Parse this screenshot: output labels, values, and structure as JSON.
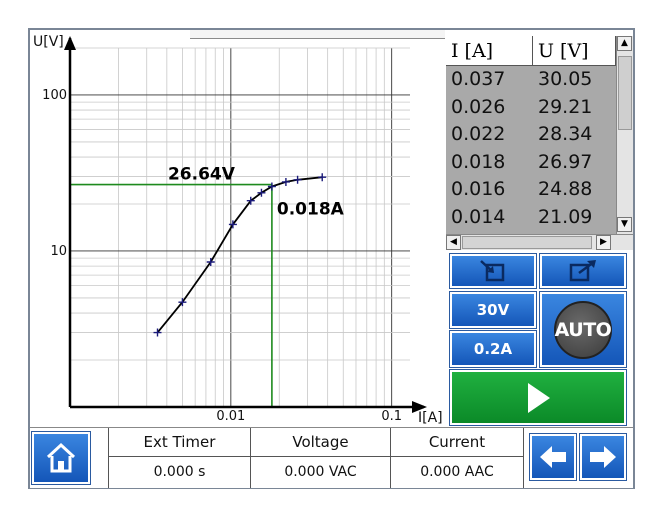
{
  "chart_data": {
    "type": "line",
    "xlabel": "I[A]",
    "ylabel": "U[V]",
    "xscale": "log",
    "yscale": "log",
    "xlim": [
      0.001,
      0.13
    ],
    "ylim": [
      1,
      200
    ],
    "x_ticks": [
      {
        "value": 0.01,
        "label": "0.01"
      },
      {
        "value": 0.1,
        "label": "0.1"
      }
    ],
    "y_ticks": [
      {
        "value": 10,
        "label": "10"
      },
      {
        "value": 100,
        "label": "100"
      }
    ],
    "grid": true,
    "series": [
      {
        "x": [
          0.0035,
          0.005,
          0.0075,
          0.0103,
          0.0133,
          0.0155,
          0.018,
          0.022,
          0.026,
          0.037
        ],
        "y": [
          3.0,
          4.7,
          8.5,
          14.8,
          21.0,
          23.6,
          25.9,
          27.7,
          28.6,
          29.7
        ]
      }
    ],
    "annotations": {
      "voltage_label": "26.64V",
      "current_label": "0.018A",
      "marker_x": 0.018,
      "marker_y": 26.64
    }
  },
  "table": {
    "headers": [
      "I [A]",
      "U [V]"
    ],
    "rows": [
      [
        "0.037",
        "30.05"
      ],
      [
        "0.026",
        "29.21"
      ],
      [
        "0.022",
        "28.34"
      ],
      [
        "0.018",
        "26.97"
      ],
      [
        "0.016",
        "24.88"
      ],
      [
        "0.014",
        "21.09"
      ]
    ]
  },
  "buttons": {
    "export_icon": "export-to-device-icon",
    "open_icon": "open-external-icon",
    "voltage_range": "30V",
    "current_range": "0.2A",
    "auto": "AUTO",
    "start_icon": "play-icon"
  },
  "status": {
    "home_icon": "home-icon",
    "ext_timer_label": "Ext Timer",
    "ext_timer_value": "0.000 s",
    "voltage_label": "Voltage",
    "voltage_value": "0.000 VAC",
    "current_label": "Current",
    "current_value": "0.000 AAC"
  },
  "colors": {
    "blue_button": "#1f6cd0",
    "green_button": "#12a034",
    "marker_line": "#1e8a1e",
    "curve": "#000000",
    "point": "#1a1a7a"
  }
}
